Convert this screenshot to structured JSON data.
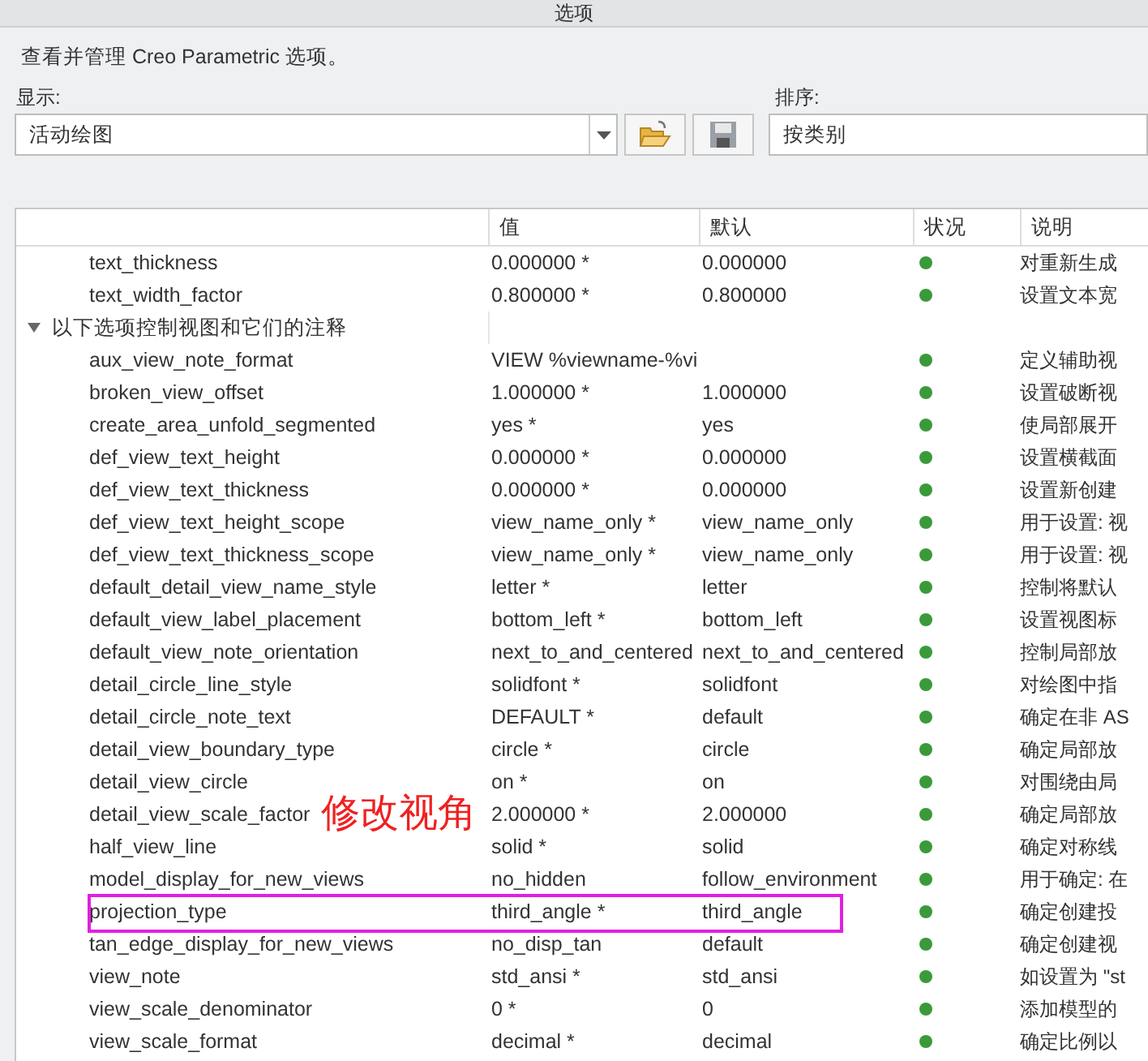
{
  "window": {
    "title": "选项"
  },
  "description": "查看并管理 Creo Parametric 选项。",
  "display": {
    "label": "显示:",
    "value": "活动绘图"
  },
  "sort": {
    "label": "排序:",
    "value": "按类别"
  },
  "table": {
    "columns": [
      "值",
      "默认",
      "状况",
      "说明"
    ],
    "rows": [
      {
        "name": "text_thickness",
        "value": "0.000000 *",
        "default": "0.000000",
        "note": "对重新生成"
      },
      {
        "name": "text_width_factor",
        "value": "0.800000 *",
        "default": "0.800000",
        "note": "设置文本宽"
      },
      {
        "kind": "group",
        "name": "以下选项控制视图和它们的注释",
        "expanded": true,
        "children": [
          {
            "name": "aux_view_note_format",
            "value": "VIEW %viewname-%vi",
            "note": "定义辅助视"
          },
          {
            "name": "broken_view_offset",
            "value": "1.000000 *",
            "default": "1.000000",
            "note": "设置破断视"
          },
          {
            "name": "create_area_unfold_segmented",
            "value": "yes *",
            "default": "yes",
            "note": "使局部展开"
          },
          {
            "name": "def_view_text_height",
            "value": "0.000000 *",
            "default": "0.000000",
            "note": "设置横截面"
          },
          {
            "name": "def_view_text_thickness",
            "value": "0.000000 *",
            "default": "0.000000",
            "note": "设置新创建"
          },
          {
            "name": "def_view_text_height_scope",
            "value": "view_name_only *",
            "default": "view_name_only",
            "note": "用于设置: 视"
          },
          {
            "name": "def_view_text_thickness_scope",
            "value": "view_name_only *",
            "default": "view_name_only",
            "note": "用于设置: 视"
          },
          {
            "name": "default_detail_view_name_style",
            "value": "letter *",
            "default": "letter",
            "note": "控制将默认"
          },
          {
            "name": "default_view_label_placement",
            "value": "bottom_left *",
            "default": "bottom_left",
            "note": "设置视图标"
          },
          {
            "name": "default_view_note_orientation",
            "value": "next_to_and_centered",
            "default": "next_to_and_centered",
            "note": "控制局部放"
          },
          {
            "name": "detail_circle_line_style",
            "value": "solidfont *",
            "default": "solidfont",
            "note": "对绘图中指"
          },
          {
            "name": "detail_circle_note_text",
            "value": "DEFAULT *",
            "default": "default",
            "note": "确定在非 AS"
          },
          {
            "name": "detail_view_boundary_type",
            "value": "circle *",
            "default": "circle",
            "note": "确定局部放"
          },
          {
            "name": "detail_view_circle",
            "value": "on *",
            "default": "on",
            "note": "对围绕由局"
          },
          {
            "name": "detail_view_scale_factor",
            "value": "2.000000 *",
            "default": "2.000000",
            "note": "确定局部放",
            "annotation": "修改视角"
          },
          {
            "name": "half_view_line",
            "value": "solid *",
            "default": "solid",
            "note": "确定对称线"
          },
          {
            "name": "model_display_for_new_views",
            "value": "no_hidden",
            "default": "follow_environment",
            "note": "用于确定: 在"
          },
          {
            "name": "projection_type",
            "value": "third_angle *",
            "default": "third_angle",
            "note": "确定创建投",
            "highlighted": true
          },
          {
            "name": "tan_edge_display_for_new_views",
            "value": "no_disp_tan",
            "default": "default",
            "note": "确定创建视"
          },
          {
            "name": "view_note",
            "value": "std_ansi *",
            "default": "std_ansi",
            "note": "如设置为 \"st"
          },
          {
            "name": "view_scale_denominator",
            "value": "0 *",
            "default": "0",
            "note": "添加模型的"
          },
          {
            "name": "view_scale_format",
            "value": "decimal *",
            "default": "decimal",
            "note": "确定比例以"
          }
        ]
      }
    ]
  }
}
